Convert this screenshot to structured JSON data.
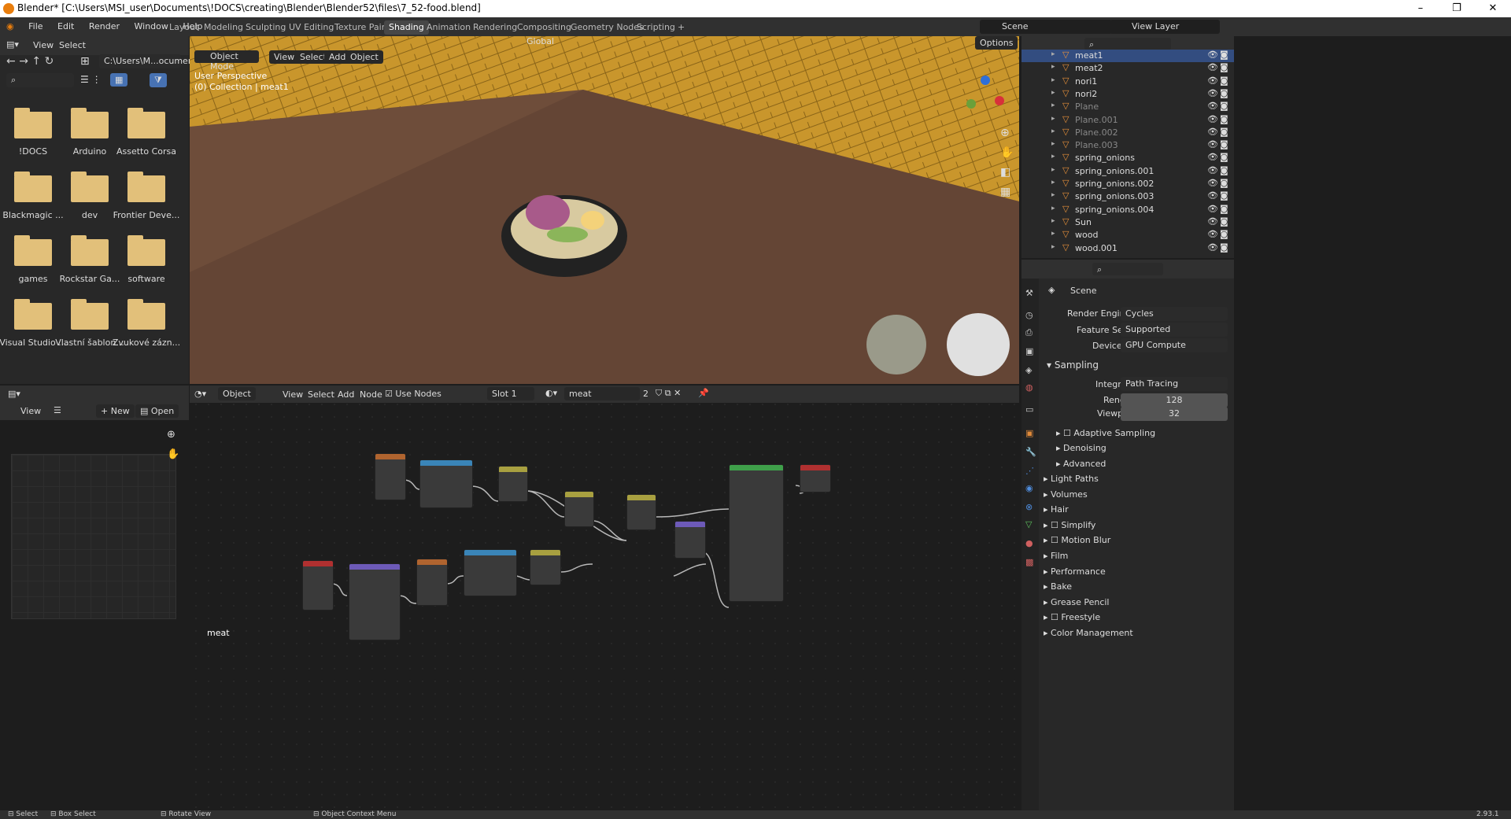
{
  "window": {
    "title": "Blender* [C:\\Users\\MSI_user\\Documents\\!DOCS\\creating\\Blender\\Blender52\\files\\7_52-food.blend]",
    "min": "–",
    "max": "❐",
    "close": "✕"
  },
  "menu": [
    "File",
    "Edit",
    "Render",
    "Window",
    "Help"
  ],
  "workspaces": [
    "Layout",
    "Modeling",
    "Sculpting",
    "UV Editing",
    "Texture Paint",
    "Shading",
    "Animation",
    "Rendering",
    "Compositing",
    "Geometry Nodes",
    "Scripting"
  ],
  "active_workspace": "Shading",
  "add_tab": "+",
  "scene": {
    "label": "Scene",
    "view_layer": "View Layer"
  },
  "filebrowser": {
    "view": "View",
    "select": "Select",
    "path": "C:\\Users\\M...ocuments\\",
    "folders": [
      "!DOCS",
      "Arduino",
      "Assetto Corsa",
      "Blackmagic ...",
      "dev",
      "Frontier Deve...",
      "games",
      "Rockstar Ga...",
      "software",
      "Visual Studio ...",
      "Vlastní šablon...",
      "Zvukové zázn..."
    ]
  },
  "viewport": {
    "mode": "Object Mode",
    "view": "View",
    "select": "Select",
    "add": "Add",
    "object": "Object",
    "orientation": "Global",
    "options": "Options",
    "persp": "User Perspective",
    "collection": "(0) Collection | meat1"
  },
  "outliner": {
    "items": [
      {
        "name": "meat1",
        "sel": true
      },
      {
        "name": "meat2"
      },
      {
        "name": "nori1"
      },
      {
        "name": "nori2"
      },
      {
        "name": "Plane",
        "dim": true
      },
      {
        "name": "Plane.001",
        "dim": true
      },
      {
        "name": "Plane.002",
        "dim": true
      },
      {
        "name": "Plane.003",
        "dim": true
      },
      {
        "name": "spring_onions"
      },
      {
        "name": "spring_onions.001"
      },
      {
        "name": "spring_onions.002"
      },
      {
        "name": "spring_onions.003"
      },
      {
        "name": "spring_onions.004"
      },
      {
        "name": "Sun"
      },
      {
        "name": "wood"
      },
      {
        "name": "wood.001"
      }
    ]
  },
  "props": {
    "scene": "Scene",
    "render_engine_label": "Render Engine",
    "render_engine": "Cycles",
    "feature_set_label": "Feature Set",
    "feature_set": "Supported",
    "device_label": "Device",
    "device": "GPU Compute",
    "sampling": "Sampling",
    "integrator_label": "Integrator",
    "integrator": "Path Tracing",
    "render_label": "Render",
    "render": "128",
    "viewport_label": "Viewport",
    "viewport": "32",
    "adaptive": "Adaptive Sampling",
    "denoising": "Denoising",
    "advanced": "Advanced",
    "sections": [
      "Light Paths",
      "Volumes",
      "Hair",
      "Simplify",
      "Motion Blur",
      "Film",
      "Performance",
      "Bake",
      "Grease Pencil",
      "Freestyle",
      "Color Management"
    ]
  },
  "image_editor": {
    "view": "View",
    "new": "New",
    "open": "Open"
  },
  "node_editor": {
    "object": "Object",
    "view": "View",
    "select": "Select",
    "add": "Add",
    "node": "Node",
    "use_nodes": "Use Nodes",
    "slot": "Slot 1",
    "material": "meat",
    "users": "2",
    "label": "meat"
  },
  "statusbar": {
    "select": "Select",
    "box_select": "Box Select",
    "rotate": "Rotate View",
    "context": "Object Context Menu",
    "version": "2.93.1"
  }
}
